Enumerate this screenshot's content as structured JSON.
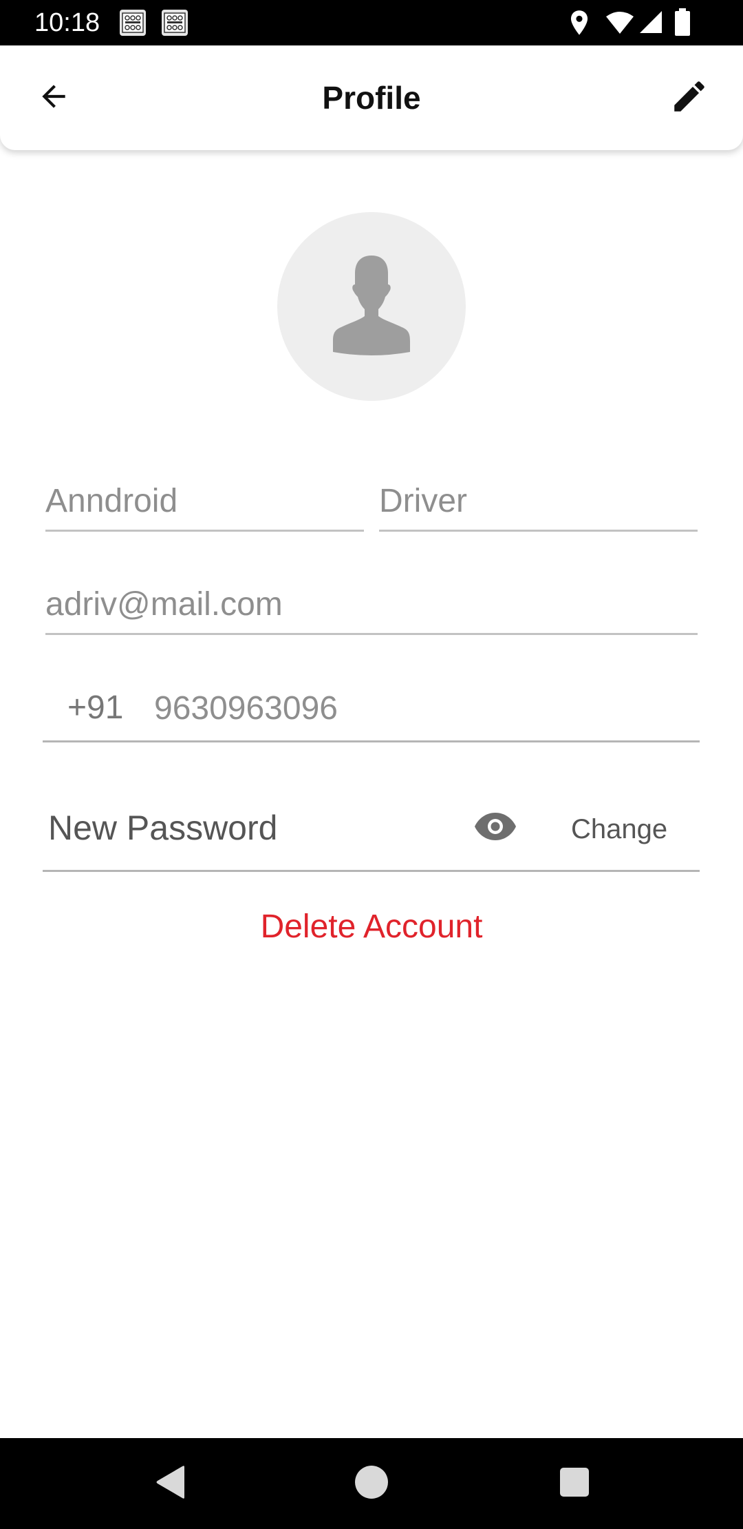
{
  "status_bar": {
    "time": "10:18",
    "notification_icons": [
      "notification-app-icon",
      "notification-app-icon"
    ],
    "right_icons": [
      "location-icon",
      "wifi-icon",
      "signal-icon",
      "battery-icon"
    ]
  },
  "app_bar": {
    "title": "Profile",
    "back_icon": "arrow-back-icon",
    "edit_icon": "pencil-edit-icon"
  },
  "avatar": {
    "icon": "person-silhouette-icon"
  },
  "form": {
    "first_name": "Anndroid",
    "last_name": "Driver",
    "email": "adriv@mail.com",
    "phone_code": "+91",
    "phone_number": "9630963096",
    "password_placeholder": "New Password",
    "change_label": "Change",
    "eye_icon": "eye-visibility-icon"
  },
  "delete_account_label": "Delete Account",
  "nav_bar": {
    "back_icon": "nav-back-triangle-icon",
    "home_icon": "nav-home-circle-icon",
    "recents_icon": "nav-recents-square-icon"
  },
  "colors": {
    "delete_red": "#e0232b",
    "field_text": "#8e8e8e",
    "avatar_bg": "#eeeeee",
    "avatar_icon": "#9e9e9e",
    "underline": "#c2c2c2"
  }
}
